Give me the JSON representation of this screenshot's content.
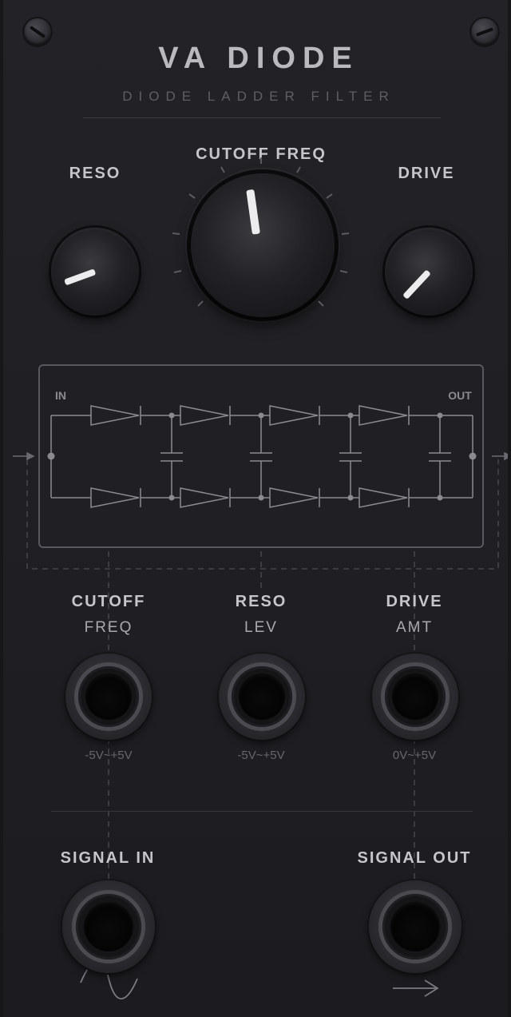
{
  "module": {
    "title": "VA DIODE",
    "subtitle": "DIODE LADDER FILTER"
  },
  "knobs": {
    "reso": {
      "label": "RESO"
    },
    "cutoff": {
      "label": "CUTOFF FREQ"
    },
    "drive": {
      "label": "DRIVE"
    }
  },
  "schematic": {
    "in_label": "IN",
    "out_label": "OUT"
  },
  "cv_inputs": [
    {
      "label": "CUTOFF",
      "sublabel": "FREQ",
      "range": "-5V~+5V"
    },
    {
      "label": "RESO",
      "sublabel": "LEV",
      "range": "-5V~+5V"
    },
    {
      "label": "DRIVE",
      "sublabel": "AMT",
      "range": "0V~+5V"
    }
  ],
  "io": {
    "signal_in": {
      "label": "SIGNAL IN",
      "icon": "sine-wave-icon"
    },
    "signal_out": {
      "label": "SIGNAL OUT",
      "icon": "arrow-right-icon"
    }
  },
  "colors": {
    "panel": "#1f1f23",
    "label": "#c5c5ca",
    "pointer": "#ececee",
    "line": "#8a8a90"
  }
}
